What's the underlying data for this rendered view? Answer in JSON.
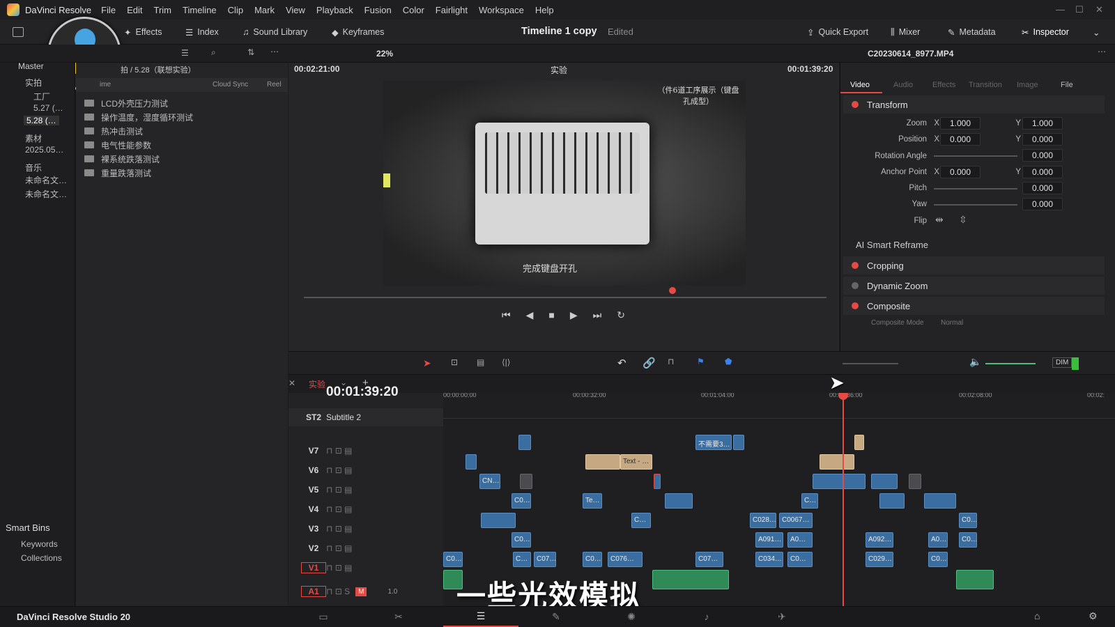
{
  "app": {
    "name": "DaVinci Resolve",
    "edition": "DaVinci Resolve Studio 20"
  },
  "menu": [
    "File",
    "Edit",
    "Trim",
    "Timeline",
    "Clip",
    "Mark",
    "View",
    "Playback",
    "Fusion",
    "Color",
    "Fairlight",
    "Workspace",
    "Help"
  ],
  "toolbar": {
    "effects": "Effects",
    "index": "Index",
    "sound_library": "Sound Library",
    "keyframes": "Keyframes",
    "timeline_title": "Timeline 1 copy",
    "edited": "Edited",
    "quick_export": "Quick Export",
    "mixer": "Mixer",
    "metadata": "Metadata",
    "inspector": "Inspector"
  },
  "subbar": {
    "zoom": "22%",
    "clip_name": "C20230614_8977.MP4"
  },
  "left_panel": {
    "master": "Master",
    "nodes": [
      "实拍",
      "工厂",
      "5.27 (…",
      "5.28 (…",
      "素材",
      "2025.05…",
      "音乐",
      "未命名文…",
      "未命名文…"
    ],
    "smart_bins": "Smart Bins",
    "keywords": "Keywords",
    "collections": "Collections"
  },
  "media_pool": {
    "breadcrumb": "拍 / 5.28（联想实验）",
    "col_name": "ime",
    "col_cloud": "Cloud Sync",
    "col_reel": "Reel",
    "folders": [
      "LCD外壳压力测试",
      "操作温度，湿度循环测试",
      "热冲击测试",
      "电气性能参数",
      "裸系统跌落测试",
      "重量跌落测试"
    ]
  },
  "viewer": {
    "timecode_left": "00:02:21:00",
    "bin": "实验",
    "timecode_right": "00:01:39:20",
    "overlay_top": "（件6道工序展示（键盘孔成型）",
    "overlay_bottom": "完成键盘开孔"
  },
  "inspector": {
    "tabs": [
      "Video",
      "Audio",
      "Effects",
      "Transition",
      "Image",
      "File"
    ],
    "transform": "Transform",
    "zoom": "Zoom",
    "zoom_x": "1.000",
    "zoom_y": "1.000",
    "position": "Position",
    "pos_x": "0.000",
    "pos_y": "0.000",
    "rotation": "Rotation Angle",
    "rotation_v": "0.000",
    "anchor": "Anchor Point",
    "anchor_x": "0.000",
    "anchor_y": "0.000",
    "pitch": "Pitch",
    "pitch_v": "0.000",
    "yaw": "Yaw",
    "yaw_v": "0.000",
    "flip": "Flip",
    "ai_reframe": "AI Smart Reframe",
    "cropping": "Cropping",
    "dynamic_zoom": "Dynamic Zoom",
    "composite": "Composite",
    "composite_mode": "Composite Mode",
    "composite_mode_v": "Normal",
    "x": "X",
    "y": "Y"
  },
  "timeline": {
    "tab": "实验",
    "timecode": "00:01:39:20",
    "ruler": [
      "00:00:00:00",
      "00:00:32:00",
      "00:01:04:00",
      "00:01:36:00",
      "00:02:08:00",
      "00:02:"
    ],
    "subtitle_track": {
      "name": "ST2",
      "label": "Subtitle 2"
    },
    "tracks": [
      "V7",
      "V6",
      "V5",
      "V4",
      "V3",
      "V2",
      "V1",
      "A1"
    ],
    "audio_level": "1.0",
    "dim": "DIM",
    "clips": {
      "v7a": "不需要3…",
      "v6a": "Text - …",
      "v5a": "CN…",
      "v4a": "C0…",
      "v4b": "Te…",
      "v4c": "C…",
      "v3a": "C…",
      "v3b": "C028…",
      "v3c": "C0067…",
      "v3d": "C0…",
      "v2a": "C0…",
      "v2b": "A091…",
      "v2c": "A0…",
      "v2d": "A092…",
      "v2e": "A0…",
      "v2f": "C0…",
      "v1a": "C0…",
      "v1b": "C…",
      "v1c": "C07…",
      "v1d": "C0…",
      "v1e": "C076…",
      "v1f": "C07…",
      "v1g": "C034…",
      "v1h": "C0…",
      "v1i": "C029…",
      "v1j": "C0…"
    }
  },
  "caption_overlay": "一些光效模拟"
}
